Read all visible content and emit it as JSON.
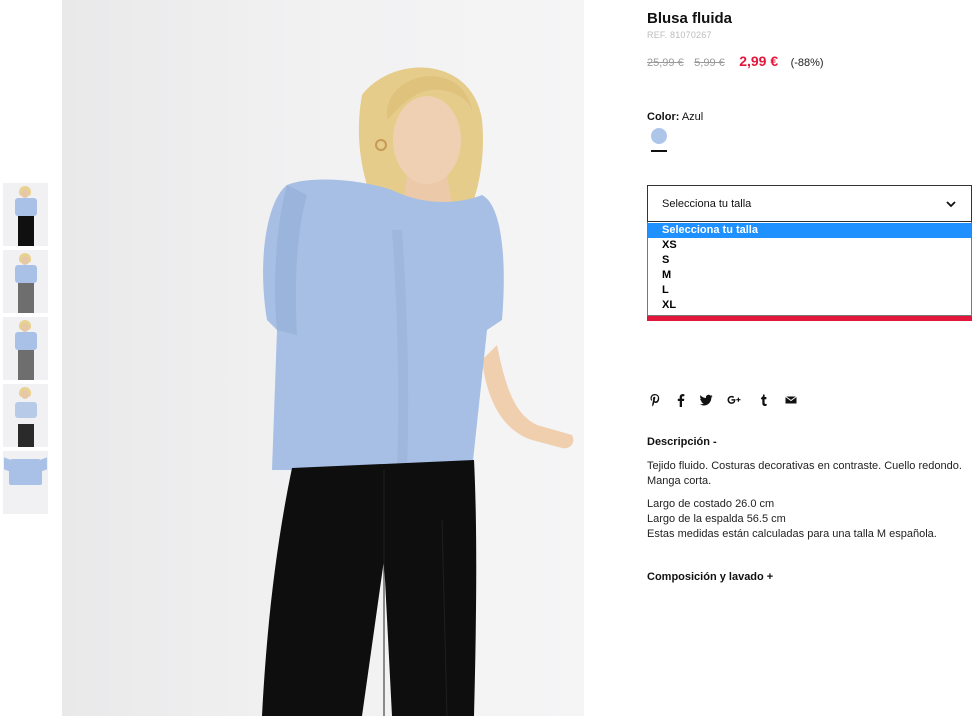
{
  "product": {
    "title": "Blusa fluida",
    "ref": "REF. 81070267",
    "price_original_1": "25,99 €",
    "price_original_2": "5,99 €",
    "price_current": "2,99 €",
    "discount": "(-88%)"
  },
  "color": {
    "label": "Color:",
    "value": "Azul",
    "swatch_color": "#aec5ea"
  },
  "size": {
    "select_label": "Selecciona tu talla",
    "options": [
      "Selecciona tu talla",
      "XS",
      "S",
      "M",
      "L",
      "XL"
    ],
    "selected_index": 0
  },
  "share": {
    "icons": [
      "pinterest-icon",
      "facebook-icon",
      "twitter-icon",
      "google-plus-icon",
      "tumblr-icon",
      "email-icon"
    ]
  },
  "description": {
    "heading": "Descripción -",
    "text": "Tejido fluido. Costuras decorativas en contraste. Cuello redondo. Manga corta.",
    "measure_1": "Largo de costado 26.0 cm",
    "measure_2": "Largo de la espalda 56.5 cm",
    "measure_note": "Estas medidas están calculadas para una talla M española."
  },
  "composition": {
    "heading": "Composición y lavado +"
  },
  "colors": {
    "accent_red": "#e3173b",
    "selected_option": "#1e90ff"
  }
}
